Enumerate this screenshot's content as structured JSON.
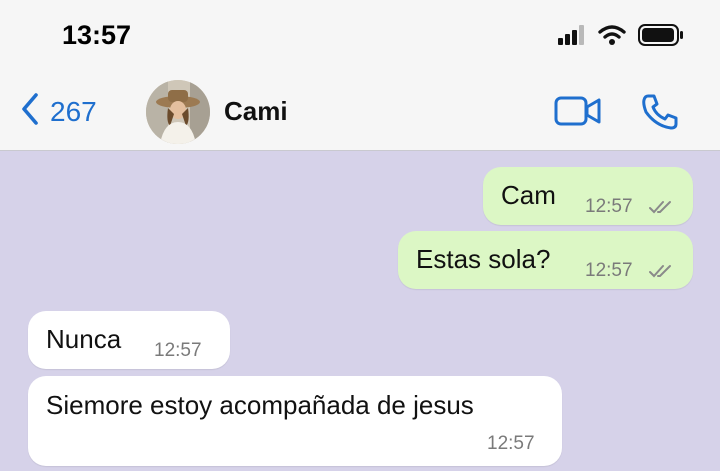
{
  "status_bar": {
    "time": "13:57",
    "icons": [
      "cellular-signal-icon",
      "wifi-icon",
      "battery-icon"
    ]
  },
  "header": {
    "back_count": "267",
    "contact_name": "Cami",
    "actions": [
      "video-call-icon",
      "voice-call-icon"
    ]
  },
  "colors": {
    "accent": "#1f6fce",
    "outgoing_bubble": "#dcf7c5",
    "incoming_bubble": "#ffffff",
    "chat_background": "#d6d2e9",
    "read_ticks": "#8a8a8a"
  },
  "messages": [
    {
      "direction": "outgoing",
      "text": "Cam",
      "time": "12:57",
      "status": "double-check-icon"
    },
    {
      "direction": "outgoing",
      "text": "Estas sola?",
      "time": "12:57",
      "status": "double-check-icon"
    },
    {
      "direction": "incoming",
      "text": "Nunca",
      "time": "12:57"
    },
    {
      "direction": "incoming",
      "text": "Siemore estoy acompañada de jesus",
      "time": "12:57"
    }
  ]
}
